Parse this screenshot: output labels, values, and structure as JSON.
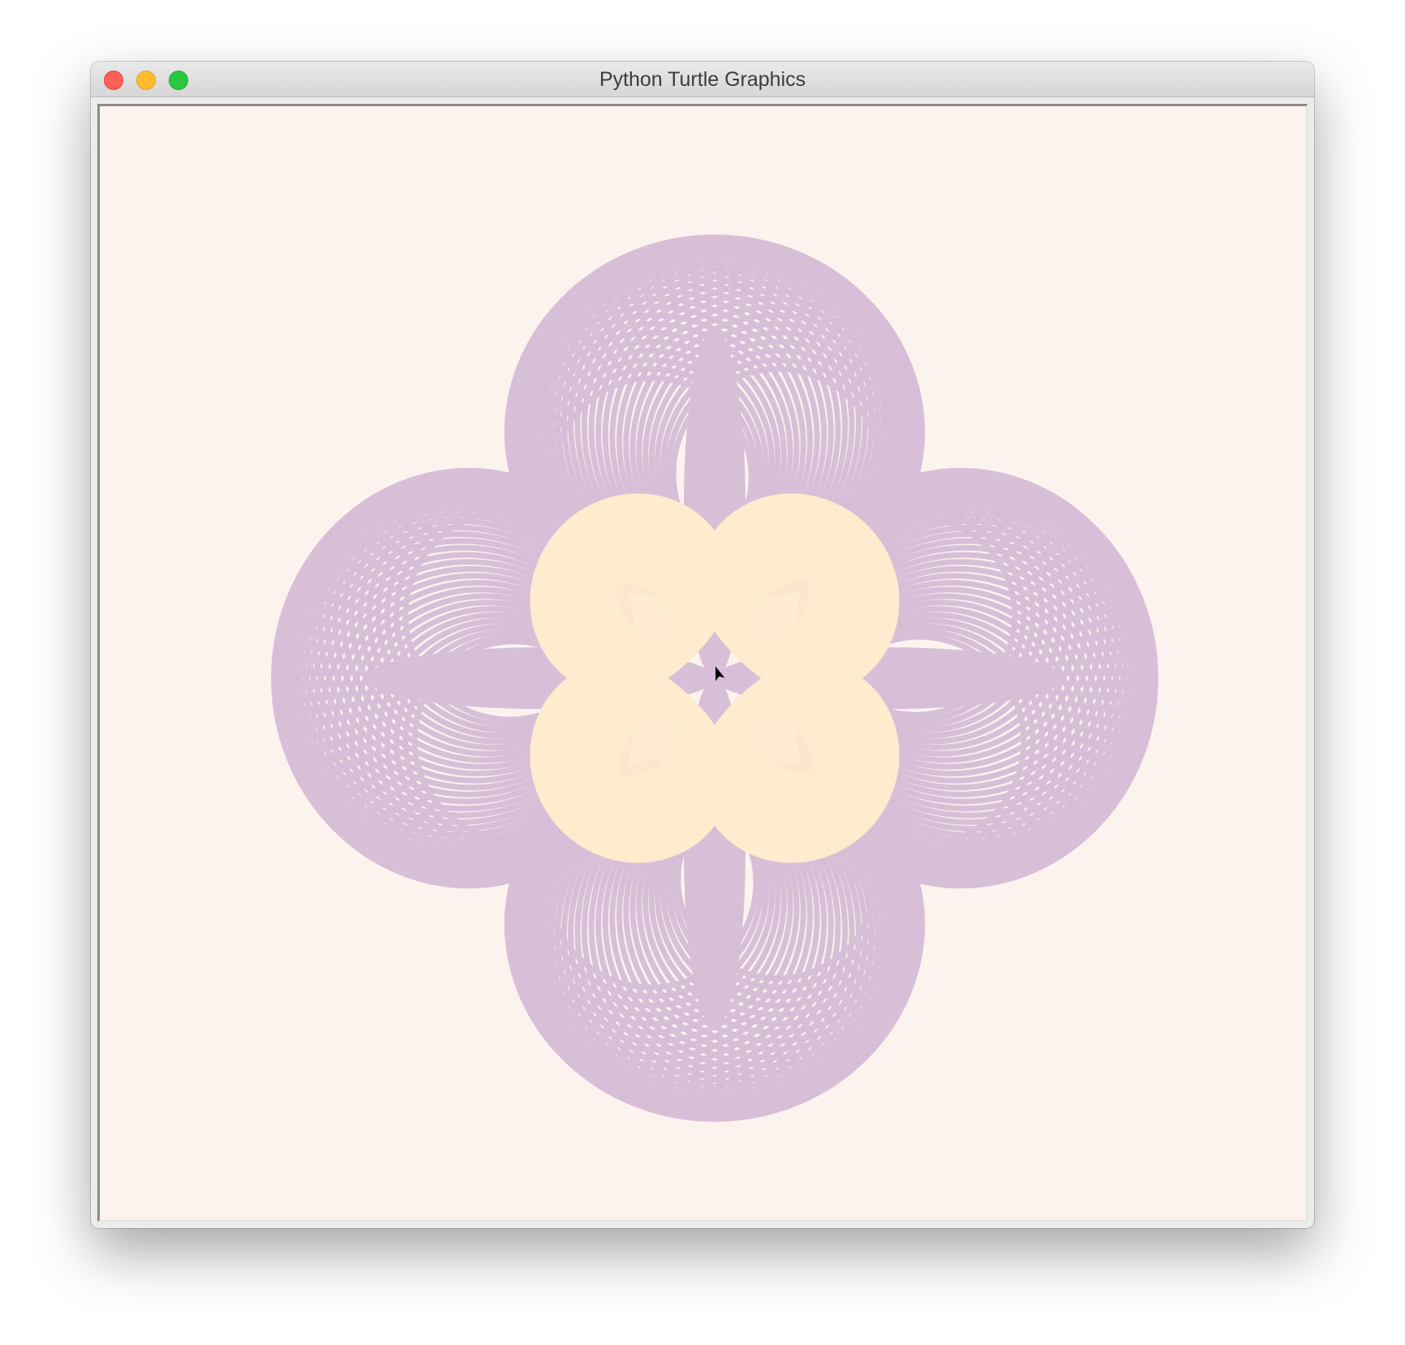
{
  "window": {
    "title": "Python Turtle Graphics"
  },
  "traffic_lights": {
    "close": "close-button",
    "minimize": "minimize-button",
    "zoom": "zoom-button"
  },
  "canvas": {
    "background": "#fdf3ee",
    "outer_petal_color": "#d8bfd8",
    "inner_petal_color": "#ffebcd",
    "turtle_color": "#000000",
    "icon": "turtle-arrow-icon"
  }
}
